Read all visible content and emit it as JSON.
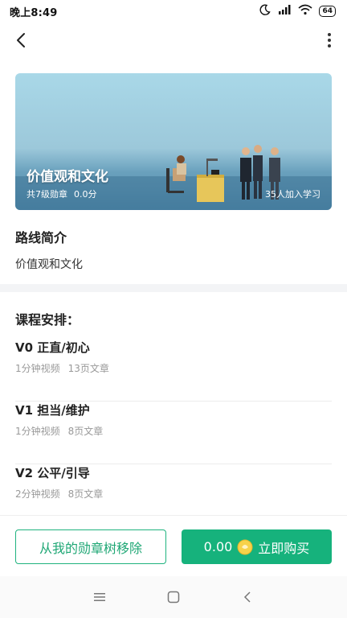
{
  "status_bar": {
    "time": "晚上8:49",
    "battery": "64"
  },
  "banner": {
    "title": "价值观和文化",
    "levels": "共7级勋章",
    "score": "0.0分",
    "joined": "35人加入学习"
  },
  "intro": {
    "heading": "路线简介",
    "text": "价值观和文化"
  },
  "schedule": {
    "heading": "课程安排：",
    "courses": [
      {
        "name": "V0 正直/初心",
        "video": "1分钟视频",
        "pages": "13页文章"
      },
      {
        "name": "V1 担当/维护",
        "video": "1分钟视频",
        "pages": "8页文章"
      },
      {
        "name": "V2 公平/引导",
        "video": "2分钟视频",
        "pages": "8页文章"
      }
    ]
  },
  "actions": {
    "remove_label": "从我的勋章树移除",
    "price": "0.00",
    "buy_label": "立即购买"
  },
  "icons": {
    "back": "back-arrow-icon",
    "more": "more-vertical-icon",
    "coin": "coin-icon",
    "nav_menu": "menu-icon",
    "nav_home": "home-square-icon",
    "nav_back": "back-chevron-icon"
  },
  "colors": {
    "accent": "#16b27c"
  }
}
